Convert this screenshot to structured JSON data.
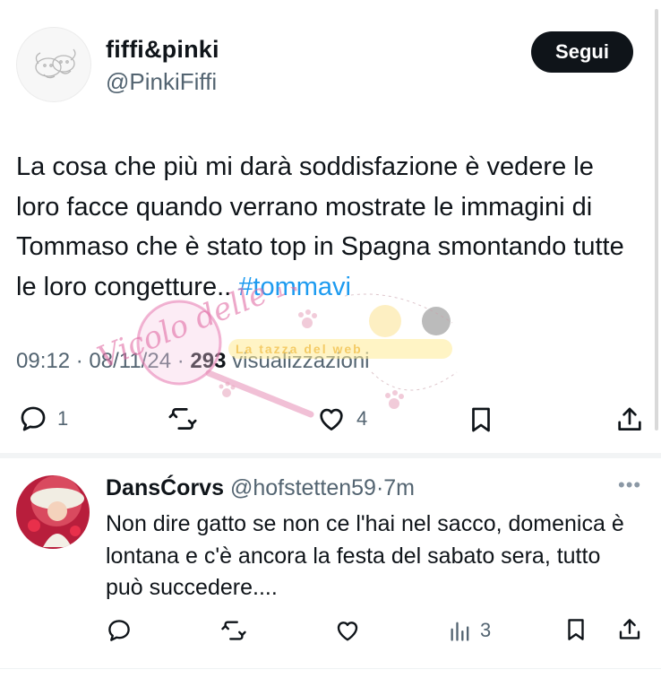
{
  "tweet": {
    "display_name": "fiffi&pinki",
    "handle": "@PinkiFiffi",
    "follow_label": "Segui",
    "text": "La cosa che più mi darà soddisfazione è vedere le loro facce quando verrano mostrate le immagini di Tommaso che è stato top in Spagna smontando tutte le loro congetture..",
    "hashtag": "#tommavi",
    "time": "09:12",
    "date": "08/11/24",
    "views_count": "293",
    "views_label": "visualizzazioni",
    "actions": {
      "reply_count": "1",
      "retweet_count": "",
      "like_count": "4"
    }
  },
  "reply": {
    "display_name": "DansĆorvs",
    "handle": "@hofstetten59",
    "time": "7m",
    "text": "Non dire gatto se non ce l'hai nel sacco, domenica è  lontana e c'è ancora la festa del sabato sera, tutto può succedere....",
    "actions": {
      "views_count": "3"
    }
  },
  "watermark": {
    "script_text": "Vicolo delle News",
    "banner_text": "La tazza del web"
  },
  "icons": {
    "reply": "reply-icon",
    "retweet": "retweet-icon",
    "like": "heart-icon",
    "bookmark": "bookmark-icon",
    "share": "share-icon",
    "views": "views-chart-icon",
    "more": "more-icon"
  },
  "colors": {
    "text": "#0f1419",
    "secondary": "#536471",
    "hashtag": "#1d9bf0",
    "follow_bg": "#0f1419"
  }
}
